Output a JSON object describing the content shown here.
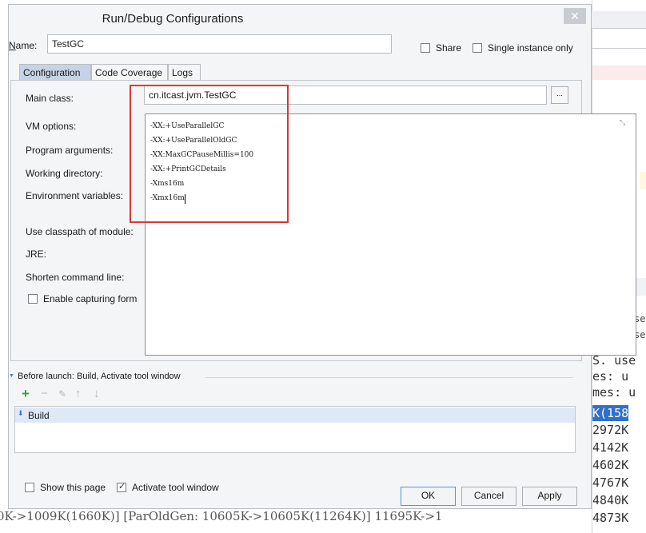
{
  "dialog": {
    "title": "Run/Debug Configurations",
    "close_icon": "close-icon"
  },
  "name_row": {
    "label": "Name:",
    "value": "TestGC",
    "share_label": "Share",
    "share_checked": false,
    "single_instance_label": "Single instance only",
    "single_instance_checked": false
  },
  "tabs": [
    {
      "label": "Configuration",
      "active": true
    },
    {
      "label": "Code Coverage",
      "active": false
    },
    {
      "label": "Logs",
      "active": false
    }
  ],
  "config": {
    "main_class_label": "Main class:",
    "main_class_value": "cn.itcast.jvm.TestGC",
    "browse_button": "...",
    "vm_options_label": "VM options:",
    "program_args_label": "Program arguments:",
    "working_dir_label": "Working directory:",
    "env_vars_label": "Environment variables:",
    "classpath_label": "Use classpath of module:",
    "jre_label": "JRE:",
    "shorten_label": "Shorten command line:",
    "enable_capturing_label": "Enable capturing form",
    "enable_capturing_checked": false
  },
  "vm_options_popup": {
    "lines": [
      "-XX:+UseParallelGC",
      "-XX:+UseParallelOldGC",
      "-XX:MaxGCPauseMillis=100",
      "-XX:+PrintGCDetails",
      "-Xms16m",
      "-Xmx16m"
    ],
    "expand_icon": "expand-icon"
  },
  "before_launch": {
    "label": "Before launch: Build, Activate tool window",
    "toolbar_icons": [
      "plus-icon",
      "minus-icon",
      "edit-icon",
      "up-arrow-icon",
      "down-arrow-icon"
    ],
    "items": [
      {
        "label": "Build",
        "icon": "build-icon"
      }
    ]
  },
  "footer": {
    "show_page_label": "Show this page",
    "show_page_checked": false,
    "activate_window_label": "Activate tool window",
    "activate_window_checked": true,
    "ok_label": "OK",
    "cancel_label": "Cancel",
    "apply_label": "Apply"
  },
  "background_console": {
    "lines": [
      "S. use",
      "es: u",
      "mes: u",
      "K(158",
      "2972K",
      "4142K",
      "4602K",
      "4767K",
      "4840K",
      "4873K"
    ],
    "tiny_lines": [
      "se",
      "se"
    ],
    "bottom_line": "0K->1009K(1660K)] [ParOldGen: 10605K->10605K(11264K)] 11695K->1"
  },
  "colors": {
    "accent_blue": "#2f6fce",
    "highlight_box": "#d9383a",
    "active_tab": "#c6d3e6"
  }
}
